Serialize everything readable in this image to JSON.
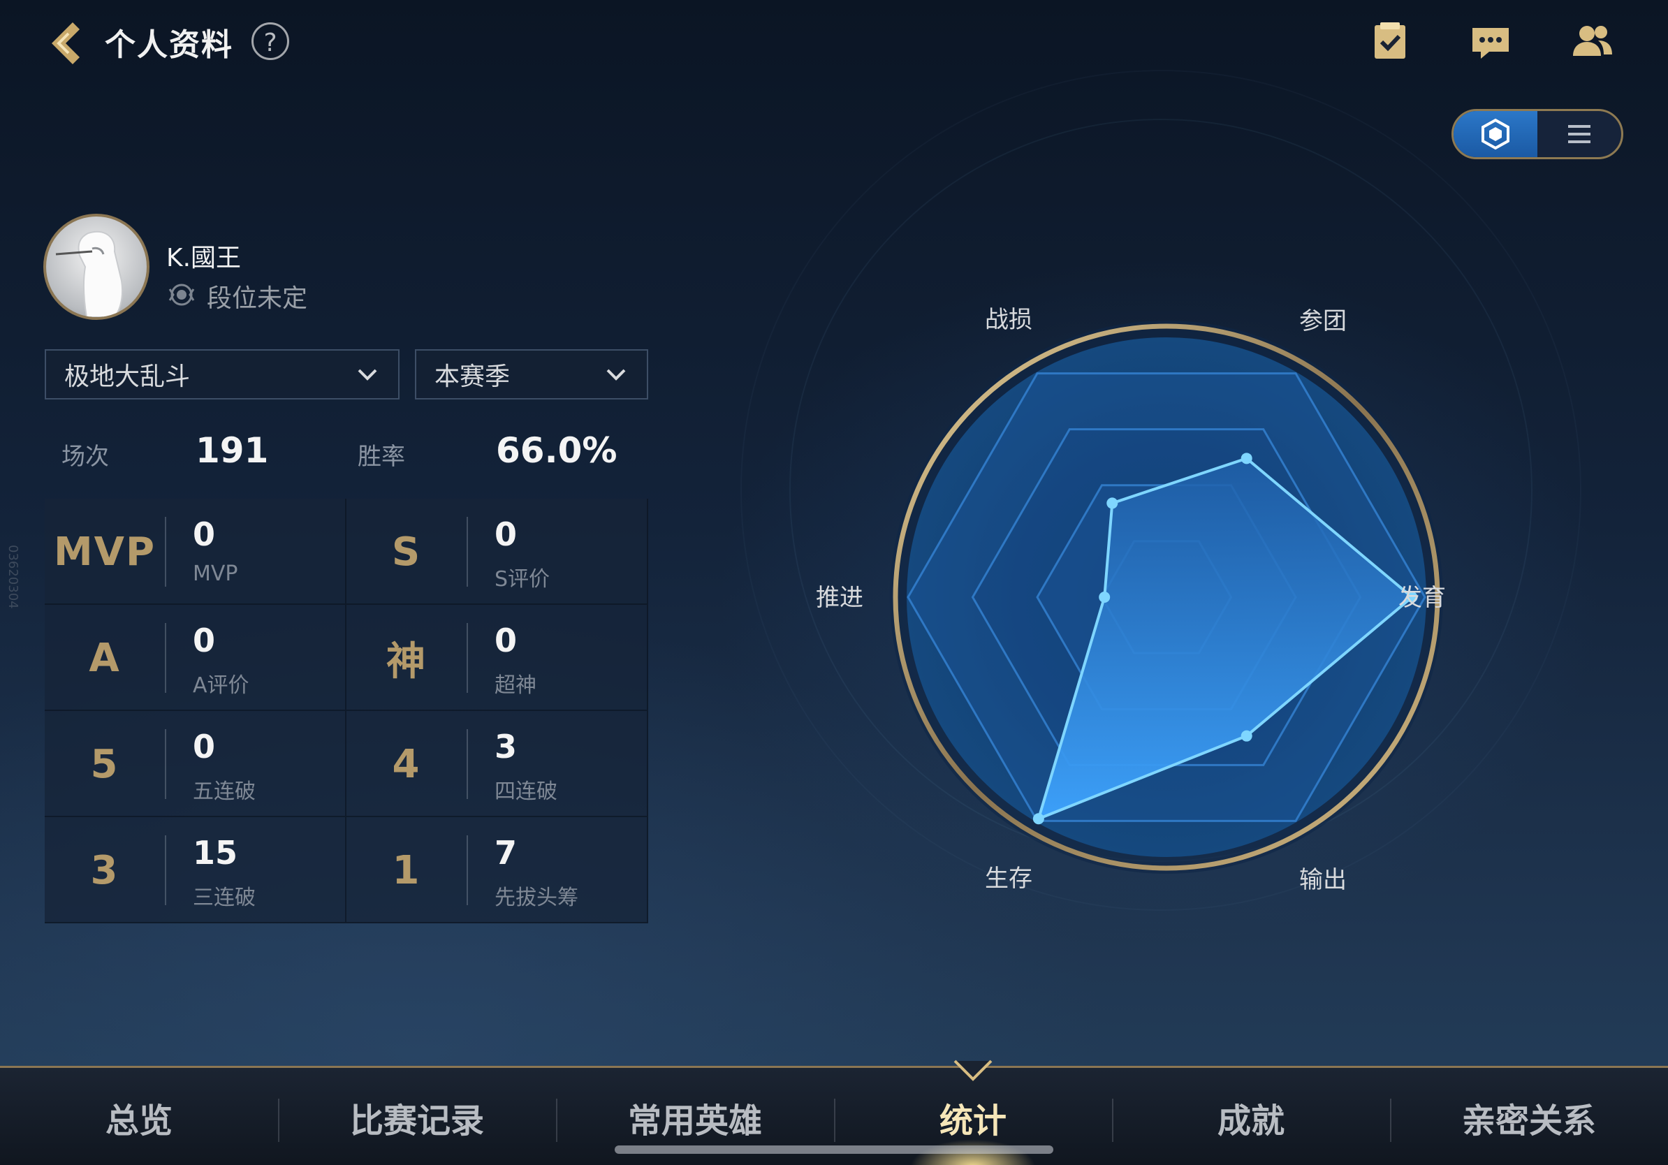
{
  "header": {
    "title": "个人资料",
    "help_label": "?",
    "icons": [
      "task-icon",
      "chat-icon",
      "friends-icon"
    ]
  },
  "view_toggle": {
    "options": [
      "radar-view-icon",
      "list-view-icon"
    ],
    "selected": "radar-view-icon"
  },
  "profile": {
    "name": "K.國王",
    "rank": "段位未定"
  },
  "filters": {
    "mode": "极地大乱斗",
    "season": "本赛季"
  },
  "summary": {
    "matches_label": "场次",
    "matches_value": "191",
    "winrate_label": "胜率",
    "winrate_value": "66.0%"
  },
  "stats": [
    {
      "badge": "MVP",
      "value": "0",
      "label": "MVP"
    },
    {
      "badge": "S",
      "value": "0",
      "label": "S评价"
    },
    {
      "badge": "A",
      "value": "0",
      "label": "A评价"
    },
    {
      "badge": "神",
      "value": "0",
      "label": "超神"
    },
    {
      "badge": "5",
      "value": "0",
      "label": "五连破"
    },
    {
      "badge": "4",
      "value": "3",
      "label": "四连破"
    },
    {
      "badge": "3",
      "value": "15",
      "label": "三连破"
    },
    {
      "badge": "1",
      "value": "7",
      "label": "先拔头筹"
    }
  ],
  "side_id": "03620304",
  "chart_data": {
    "type": "radar",
    "axes": [
      "战损",
      "参团",
      "发育",
      "输出",
      "生存",
      "推进"
    ],
    "values": [
      0.42,
      0.62,
      0.95,
      0.62,
      0.99,
      0.24
    ],
    "max": 1.0,
    "rings": 4
  },
  "tabs": [
    {
      "label": "总览"
    },
    {
      "label": "比赛记录"
    },
    {
      "label": "常用英雄"
    },
    {
      "label": "统计"
    },
    {
      "label": "成就"
    },
    {
      "label": "亲密关系"
    }
  ],
  "active_tab": "统计",
  "colors": {
    "gold": "#b49a6a",
    "accent_blue": "#2b77c8",
    "radar_fill": "#2f8fe6",
    "radar_line": "#7fd6ff"
  }
}
